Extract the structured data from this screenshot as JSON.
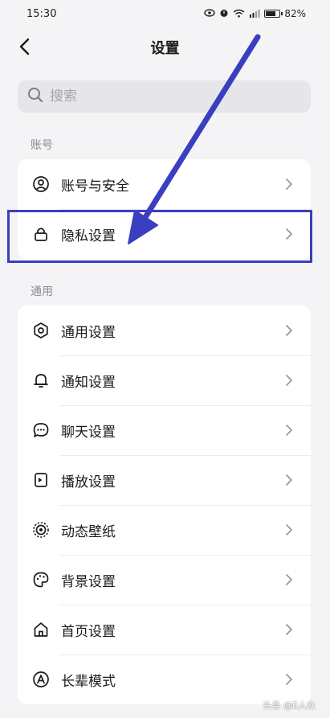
{
  "status_bar": {
    "time": "15:30",
    "battery": "82%",
    "icons": [
      "eye-icon",
      "alarm-icon",
      "wifi-icon",
      "signal-icon",
      "battery-icon"
    ]
  },
  "header": {
    "title": "设置",
    "back_icon": "chevron-left-icon"
  },
  "search": {
    "placeholder": "搜索",
    "value": ""
  },
  "sections": [
    {
      "label": "账号",
      "items": [
        {
          "label": "账号与安全",
          "icon": "user-circle-icon"
        },
        {
          "label": "隐私设置",
          "icon": "lock-icon"
        }
      ]
    },
    {
      "label": "通用",
      "items": [
        {
          "label": "通用设置",
          "icon": "gear-icon"
        },
        {
          "label": "通知设置",
          "icon": "bell-icon"
        },
        {
          "label": "聊天设置",
          "icon": "chat-bubble-icon"
        },
        {
          "label": "播放设置",
          "icon": "play-device-icon"
        },
        {
          "label": "动态壁纸",
          "icon": "live-wallpaper-icon"
        },
        {
          "label": "背景设置",
          "icon": "palette-icon"
        },
        {
          "label": "首页设置",
          "icon": "home-icon"
        },
        {
          "label": "长辈模式",
          "icon": "elder-mode-icon"
        }
      ]
    }
  ],
  "annotation": {
    "highlight_color": "#3a3fbf",
    "highlighted_item": "隐私设置"
  },
  "watermark": "头条 @E人众"
}
